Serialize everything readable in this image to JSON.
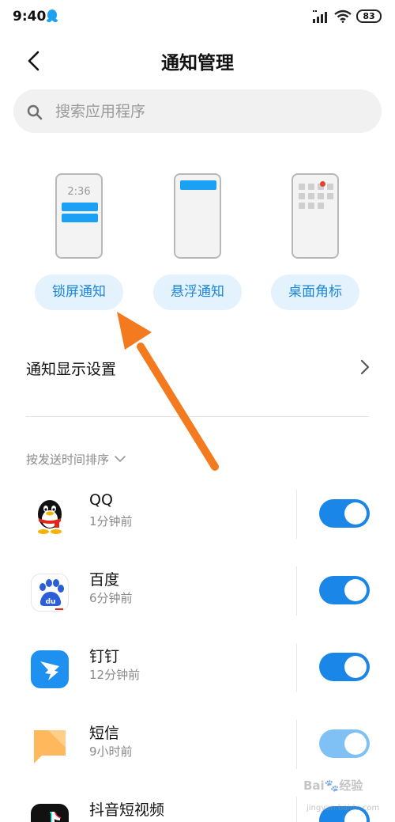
{
  "status_bar": {
    "time": "9:40",
    "battery": "83"
  },
  "header": {
    "title": "通知管理"
  },
  "search": {
    "placeholder": "搜索应用程序"
  },
  "notification_styles": {
    "lock_screen": {
      "label": "锁屏通知",
      "preview_time": "2:36"
    },
    "floating": {
      "label": "悬浮通知"
    },
    "badge": {
      "label": "桌面角标"
    }
  },
  "display_settings": {
    "label": "通知显示设置"
  },
  "sort": {
    "label": "按发送时间排序"
  },
  "apps": [
    {
      "name": "QQ",
      "time": "1分钟前",
      "icon": "qq-penguin-icon",
      "enabled": true
    },
    {
      "name": "百度",
      "time": "6分钟前",
      "icon": "baidu-paw-icon",
      "enabled": true
    },
    {
      "name": "钉钉",
      "time": "12分钟前",
      "icon": "dingtalk-icon",
      "enabled": true
    },
    {
      "name": "短信",
      "time": "9小时前",
      "icon": "sms-bubble-icon",
      "enabled": true,
      "dimmed": true
    },
    {
      "name": "抖音短视频",
      "time": "",
      "icon": "douyin-icon",
      "enabled": true
    }
  ],
  "colors": {
    "accent": "#1a86e8",
    "pill_bg": "#e3f2fd",
    "pill_text": "#1c86d8",
    "arrow": "#f47a20"
  },
  "watermark": {
    "text": "Bai🐾经验",
    "sub": "jingyan.baidu.com"
  }
}
